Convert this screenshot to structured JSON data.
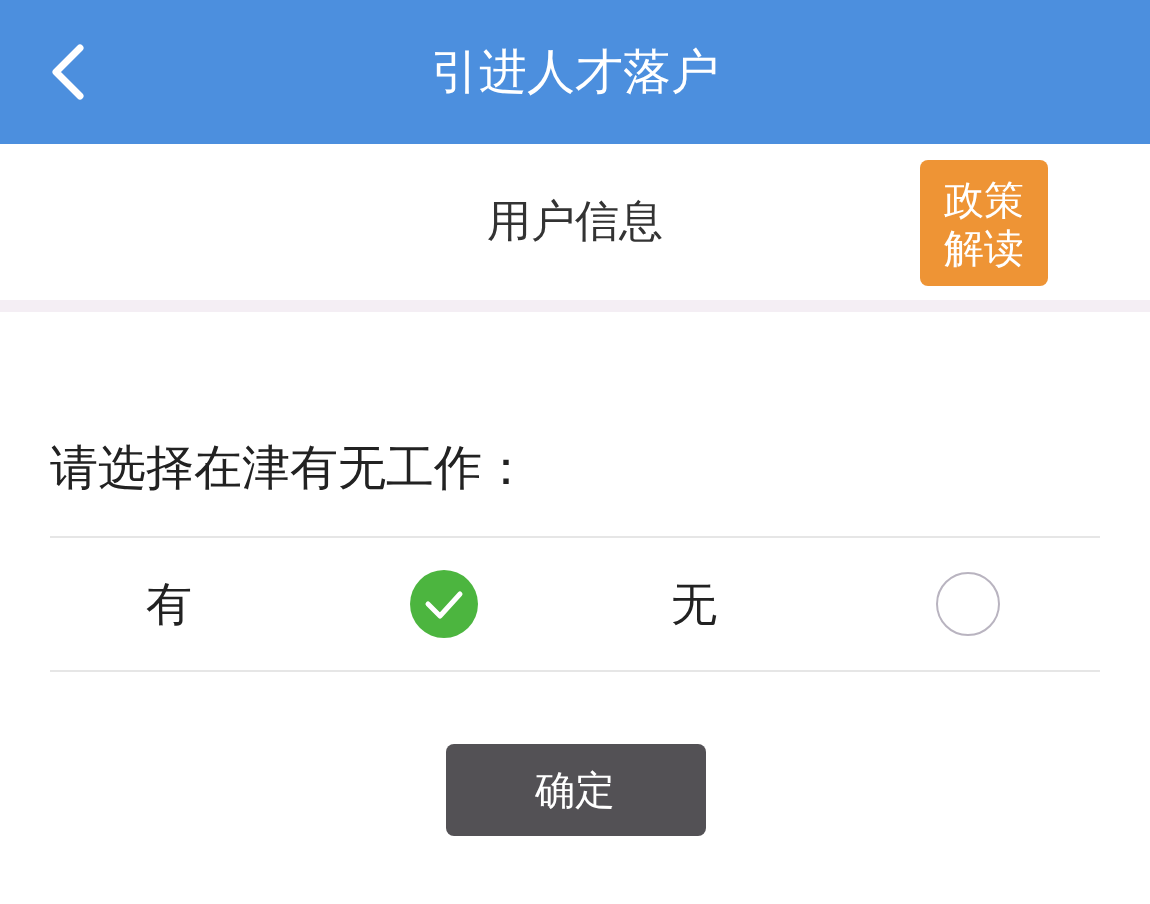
{
  "header": {
    "title": "引进人才落户"
  },
  "subheader": {
    "title": "用户信息",
    "policy_button": "政策解读"
  },
  "question": "请选择在津有无工作：",
  "options": [
    {
      "label": "有",
      "selected": true
    },
    {
      "label": "无",
      "selected": false
    }
  ],
  "confirm_button": "确定"
}
